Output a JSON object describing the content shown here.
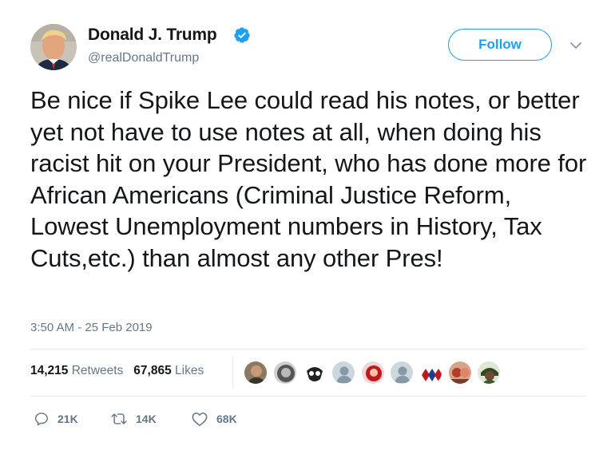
{
  "author": {
    "display_name": "Donald J. Trump",
    "handle": "@realDonaldTrump",
    "verified": true,
    "verified_color": "#1da1f2"
  },
  "follow_button": {
    "label": "Follow",
    "color": "#1da1f2"
  },
  "tweet": {
    "text": "Be nice if Spike Lee could read his notes, or better yet not have to use notes at all, when doing his racist hit on your President, who has done more for African Americans (Criminal Justice Reform, Lowest Unemployment numbers in History, Tax Cuts,etc.) than almost any other Pres!",
    "timestamp": "3:50 AM - 25 Feb 2019"
  },
  "stats": {
    "retweets_count": "14,215",
    "retweets_label": "Retweets",
    "likes_count": "67,865",
    "likes_label": "Likes"
  },
  "likers": [
    {
      "icon": "avatar-photo"
    },
    {
      "icon": "avatar-photo"
    },
    {
      "icon": "avatar-logo"
    },
    {
      "icon": "default-avatar"
    },
    {
      "icon": "avatar-photo"
    },
    {
      "icon": "default-avatar"
    },
    {
      "icon": "avatar-graphic"
    },
    {
      "icon": "avatar-photo"
    },
    {
      "icon": "avatar-photo"
    }
  ],
  "actions": {
    "replies": "21K",
    "retweets": "14K",
    "likes": "68K"
  }
}
